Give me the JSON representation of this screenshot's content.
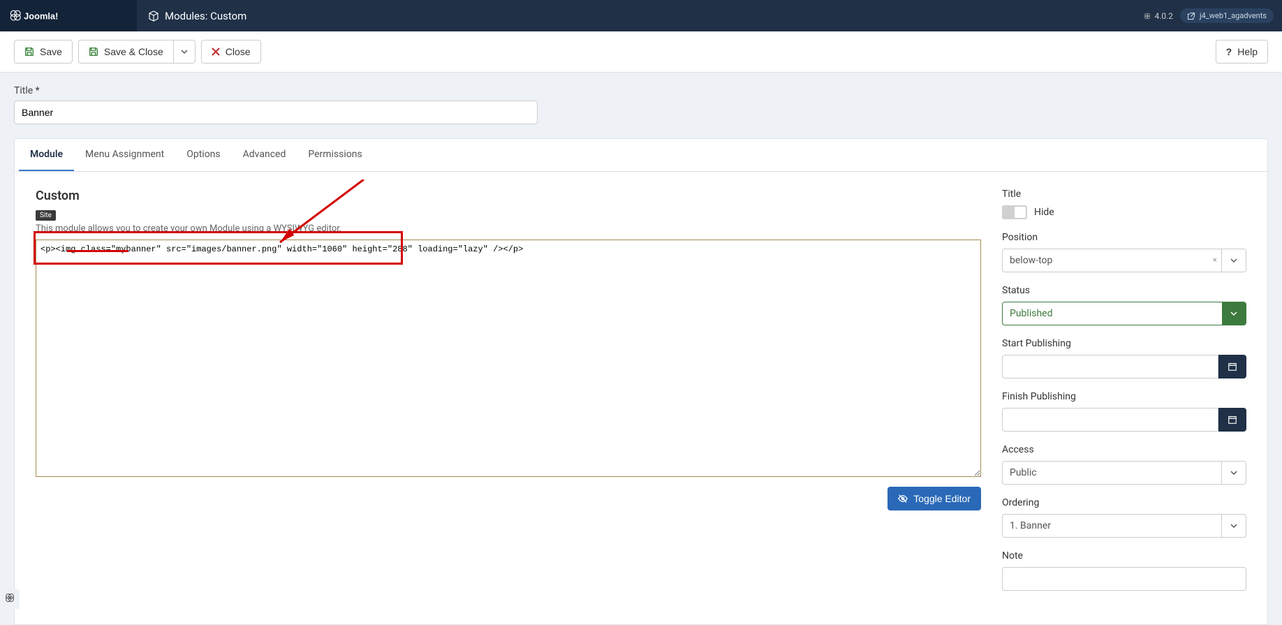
{
  "header": {
    "brand": "Joomla!",
    "page_title": "Modules: Custom",
    "version": "4.0.2",
    "site_name": "j4_web1_agadvents"
  },
  "toolbar": {
    "save": "Save",
    "save_close": "Save & Close",
    "close": "Close",
    "help": "Help"
  },
  "title_field": {
    "label": "Title",
    "required": "*",
    "value": "Banner"
  },
  "tabs": {
    "module": "Module",
    "menu_assignment": "Menu Assignment",
    "options": "Options",
    "advanced": "Advanced",
    "permissions": "Permissions"
  },
  "module_panel": {
    "heading": "Custom",
    "badge": "Site",
    "description": "This module allows you to create your own Module using a WYSIWYG editor.",
    "editor_content": "<p><img class=\"mybanner\" src=\"images/banner.png\" width=\"1060\" height=\"288\" loading=\"lazy\" /></p>",
    "toggle_editor": "Toggle Editor"
  },
  "sidebar": {
    "title_label": "Title",
    "title_toggle": "Hide",
    "position_label": "Position",
    "position_value": "below-top",
    "status_label": "Status",
    "status_value": "Published",
    "start_label": "Start Publishing",
    "start_value": "",
    "finish_label": "Finish Publishing",
    "finish_value": "",
    "access_label": "Access",
    "access_value": "Public",
    "ordering_label": "Ordering",
    "ordering_value": "1. Banner",
    "note_label": "Note",
    "note_value": ""
  }
}
